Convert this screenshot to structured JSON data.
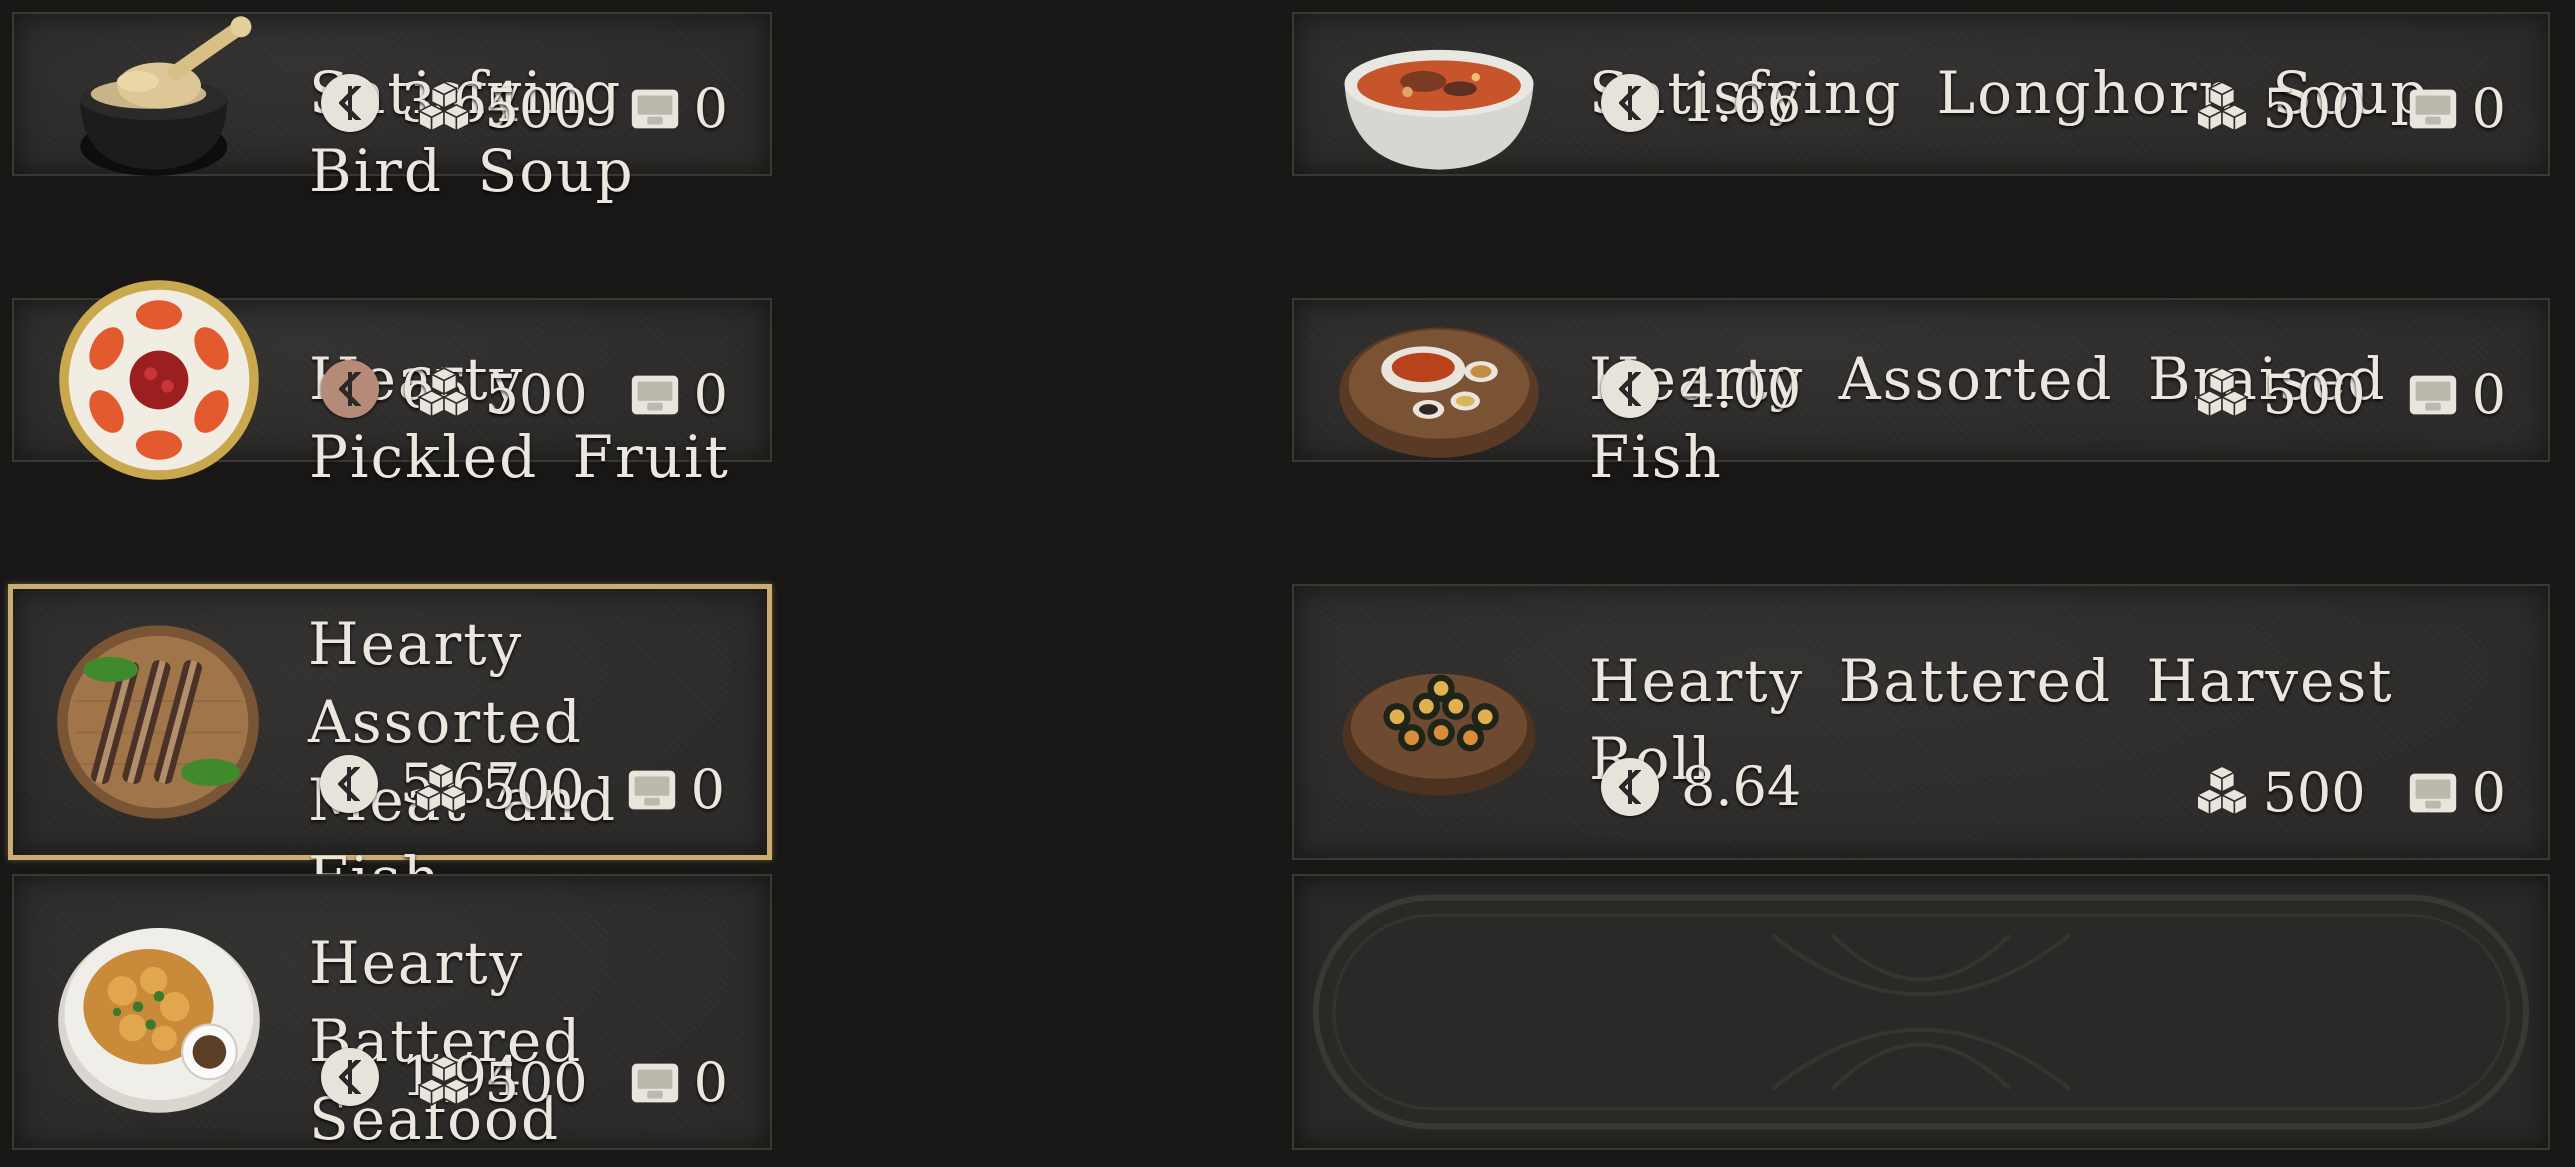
{
  "items": [
    {
      "name": "Satisfying Bird Soup",
      "price": "3.64",
      "coin": "silver",
      "weight": "500",
      "count": "0",
      "icon": "bird-soup-pot-icon",
      "selected": false
    },
    {
      "name": "Satisfying Longhorn Soup",
      "price": "1.66",
      "coin": "silver",
      "weight": "500",
      "count": "0",
      "icon": "longhorn-soup-bowl-icon",
      "selected": false
    },
    {
      "name": "Hearty Pickled Fruit",
      "price": "65",
      "coin": "copper",
      "weight": "500",
      "count": "0",
      "icon": "pickled-fruit-plate-icon",
      "selected": false
    },
    {
      "name": "Hearty Assorted Braised Fish",
      "price": "4.00",
      "coin": "silver",
      "weight": "500",
      "count": "0",
      "icon": "braised-fish-tray-icon",
      "selected": false
    },
    {
      "name": "Hearty Assorted Meat and Fish Skewers",
      "price": "5.67",
      "coin": "silver",
      "weight": "500",
      "count": "0",
      "icon": "skewers-basket-icon",
      "selected": true
    },
    {
      "name": "Hearty Battered Harvest Roll",
      "price": "8.64",
      "coin": "silver",
      "weight": "500",
      "count": "0",
      "icon": "harvest-roll-tray-icon",
      "selected": false
    },
    {
      "name": "Hearty Battered Seafood",
      "price": "1.94",
      "coin": "silver",
      "weight": "500",
      "count": "0",
      "icon": "battered-seafood-plate-icon",
      "selected": false
    }
  ],
  "colors": {
    "background": "#181716",
    "card": "#2c2b29",
    "selected_border": "#c9ad72",
    "text": "#ece7de",
    "silver_coin": "#e8e3da",
    "copper_coin": "#b58a78"
  }
}
